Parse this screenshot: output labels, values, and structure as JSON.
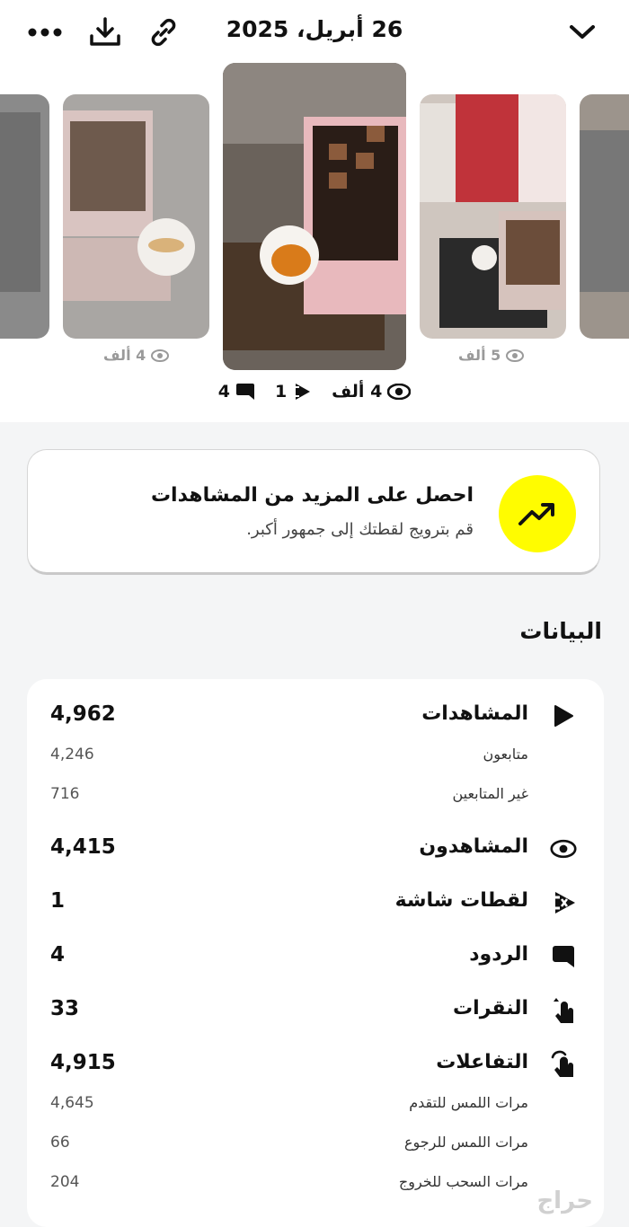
{
  "header": {
    "date": "26 أبريل، 2025",
    "icons": [
      "chevron-down-icon",
      "link-icon",
      "download-icon",
      "more-icon"
    ]
  },
  "thumbnails": [
    {
      "views": "4 ألف"
    },
    {
      "views": "5 ألف"
    }
  ],
  "current_snap": {
    "views": "4 ألف",
    "screenshots": "1",
    "replies": "4"
  },
  "promo": {
    "title": "احصل على المزيد من المشاهدات",
    "subtitle": "قم بترويج لقطتك إلى جمهور أكبر.",
    "accent": "#fffc00"
  },
  "insights": {
    "title": "البيانات",
    "rows": [
      {
        "label": "المشاهدات",
        "value": "4,962"
      },
      {
        "label": "متابعون",
        "value": "4,246"
      },
      {
        "label": "غير المتابعين",
        "value": "716"
      },
      {
        "label": "المشاهدون",
        "value": "4,415"
      },
      {
        "label": "لقطات شاشة",
        "value": "1"
      },
      {
        "label": "الردود",
        "value": "4"
      },
      {
        "label": "النقرات",
        "value": "33"
      },
      {
        "label": "التفاعلات",
        "value": "4,915"
      },
      {
        "label": "مرات اللمس للتقدم",
        "value": "4,645"
      },
      {
        "label": "مرات اللمس للرجوع",
        "value": "66"
      },
      {
        "label": "مرات السحب للخروج",
        "value": "204"
      }
    ]
  },
  "watermark": "حراج"
}
